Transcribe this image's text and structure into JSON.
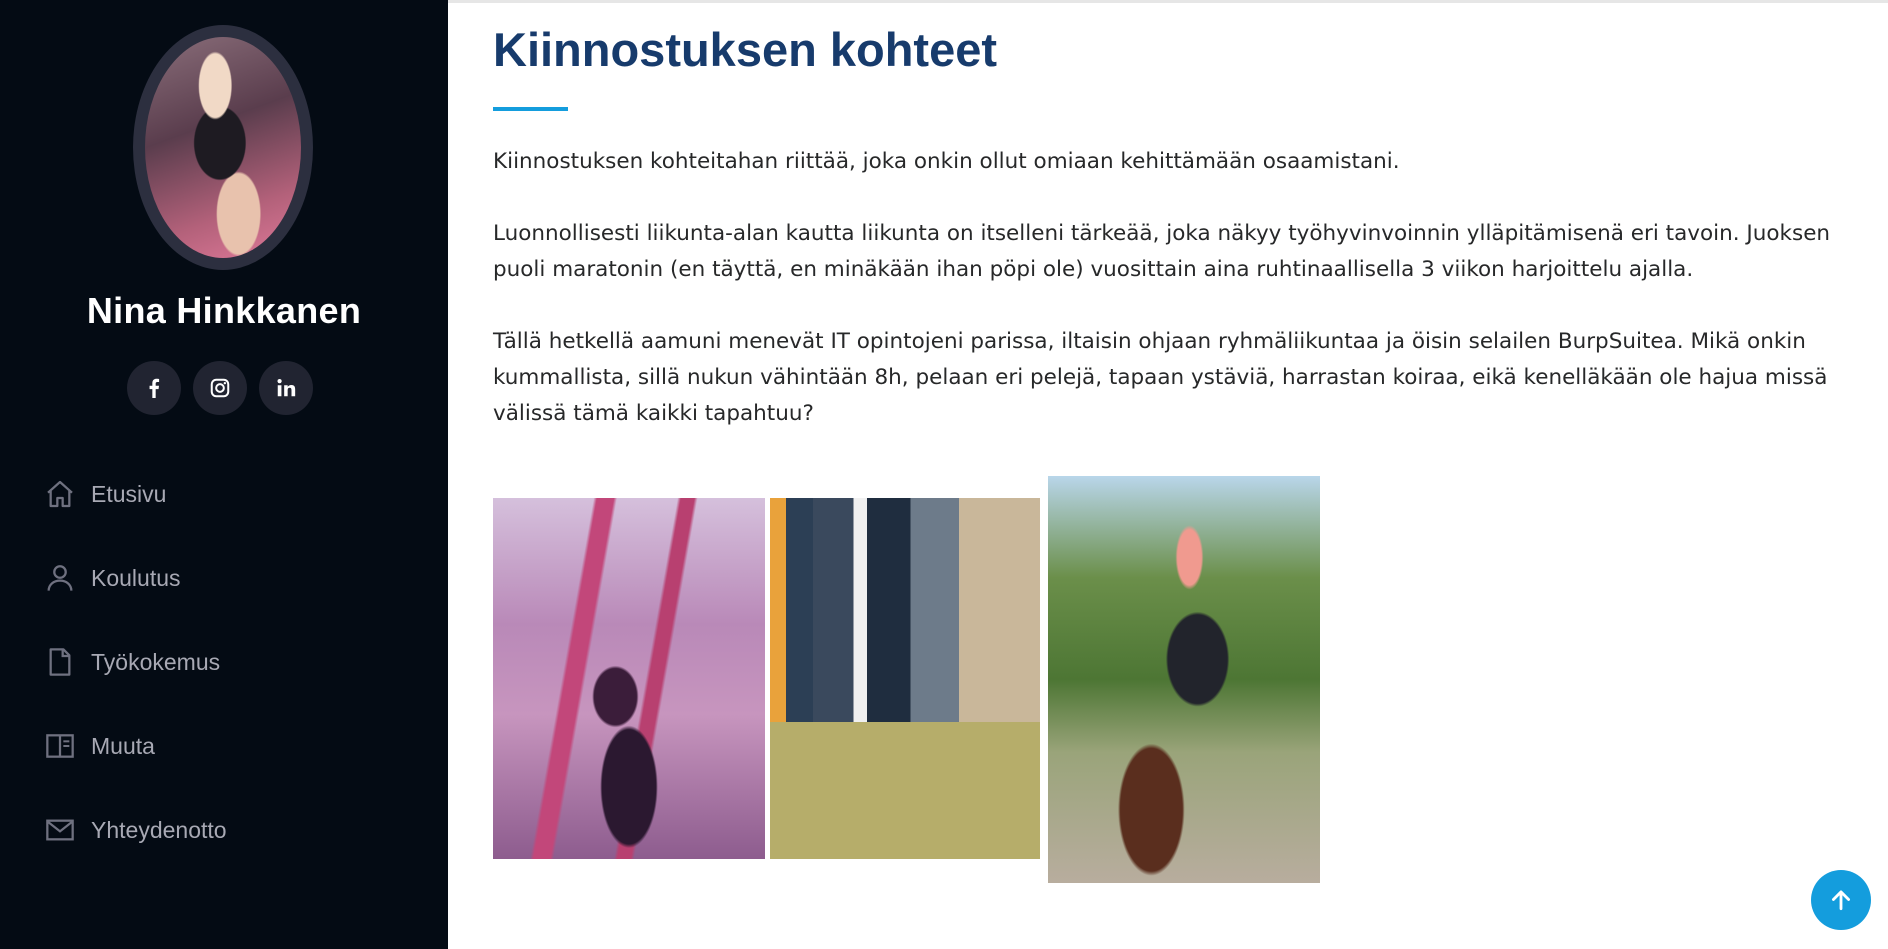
{
  "sidebar": {
    "name": "Nina Hinkkanen",
    "social": [
      {
        "icon": "facebook-icon",
        "glyph": "f"
      },
      {
        "icon": "instagram-icon",
        "glyph": ""
      },
      {
        "icon": "linkedin-icon",
        "glyph": "in"
      }
    ],
    "nav": [
      {
        "label": "Etusivu",
        "icon": "home-icon"
      },
      {
        "label": "Koulutus",
        "icon": "person-icon"
      },
      {
        "label": "Työkokemus",
        "icon": "file-icon"
      },
      {
        "label": "Muuta",
        "icon": "book-icon"
      },
      {
        "label": "Yhteydenotto",
        "icon": "envelope-icon"
      }
    ]
  },
  "main": {
    "title": "Kiinnostuksen kohteet",
    "paragraphs": [
      "Kiinnostuksen kohteitahan riittää, joka onkin ollut omiaan kehittämään osaamistani.",
      "Luonnollisesti liikunta-alan kautta liikunta on itselleni tärkeää, joka näkyy työhyvinvoinnin ylläpitämisenä eri tavoin. Juoksen puoli maratonin (en täyttä, en minäkään ihan pöpi ole) vuosittain aina ruhtinaallisella 3 viikon harjoittelu ajalla.",
      "Tällä hetkellä aamuni menevät IT opintojeni parissa, iltaisin ohjaan ryhmäliikuntaa ja öisin selailen BurpSuitea. Mikä onkin kummallista, sillä nukun vähintään 8h, pelaan eri pelejä, tapaan ystäviä, harrastan koiraa, eikä kenelläkään ole hajua missä välissä tämä kaikki tapahtuu?"
    ]
  },
  "colors": {
    "sidebar_bg": "#040b14",
    "accent": "#149ddd",
    "title": "#173b6c"
  }
}
